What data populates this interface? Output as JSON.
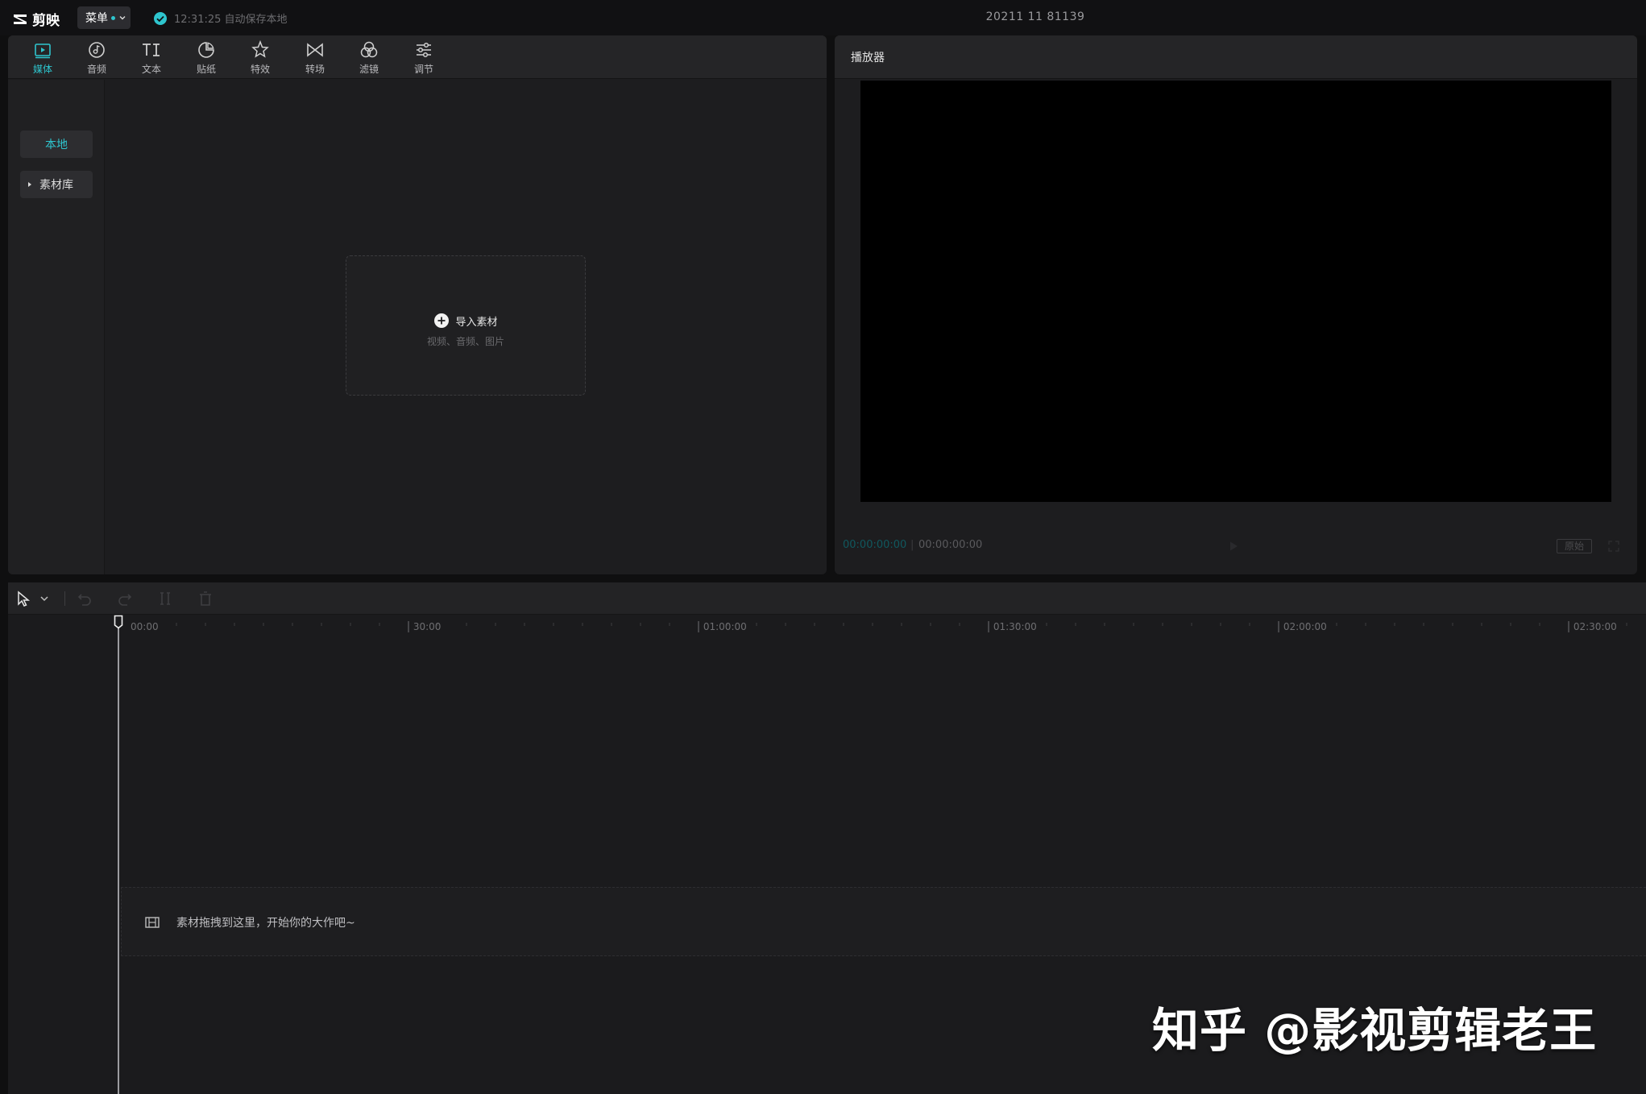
{
  "app": {
    "logo_text": "剪映",
    "menu_label": "菜单",
    "save_status": "12:31:25 自动保存本地",
    "project_name": "20211 11 81139"
  },
  "colors": {
    "accent": "#2ec5ce",
    "panel_bg": "#1d1d1f",
    "app_bg": "#0f0f10",
    "video_bg": "#000000"
  },
  "media_toolbar": {
    "items": [
      {
        "label": "媒体",
        "icon": "media-icon",
        "active": true
      },
      {
        "label": "音频",
        "icon": "audio-icon",
        "active": false
      },
      {
        "label": "文本",
        "icon": "text-icon",
        "active": false
      },
      {
        "label": "贴纸",
        "icon": "sticker-icon",
        "active": false
      },
      {
        "label": "特效",
        "icon": "effects-icon",
        "active": false
      },
      {
        "label": "转场",
        "icon": "transition-icon",
        "active": false
      },
      {
        "label": "滤镜",
        "icon": "filter-icon",
        "active": false
      },
      {
        "label": "调节",
        "icon": "adjust-icon",
        "active": false
      }
    ]
  },
  "media_nav": {
    "local": "本地",
    "library": "素材库"
  },
  "import": {
    "label": "导入素材",
    "hint": "视频、音频、图片"
  },
  "player": {
    "title": "播放器",
    "time_current": "00:00:00:00",
    "time_separator": "|",
    "time_total": "00:00:00:00",
    "ratio_label": "原始"
  },
  "timeline": {
    "ruler_labels": [
      "00:00",
      "| 30:00",
      "| 01:00:00",
      "| 01:30:00",
      "| 02:00:00",
      "| 02:30:00"
    ],
    "drop_hint": "素材拖拽到这里，开始你的大作吧~"
  },
  "watermark": "知乎 @影视剪辑老王"
}
